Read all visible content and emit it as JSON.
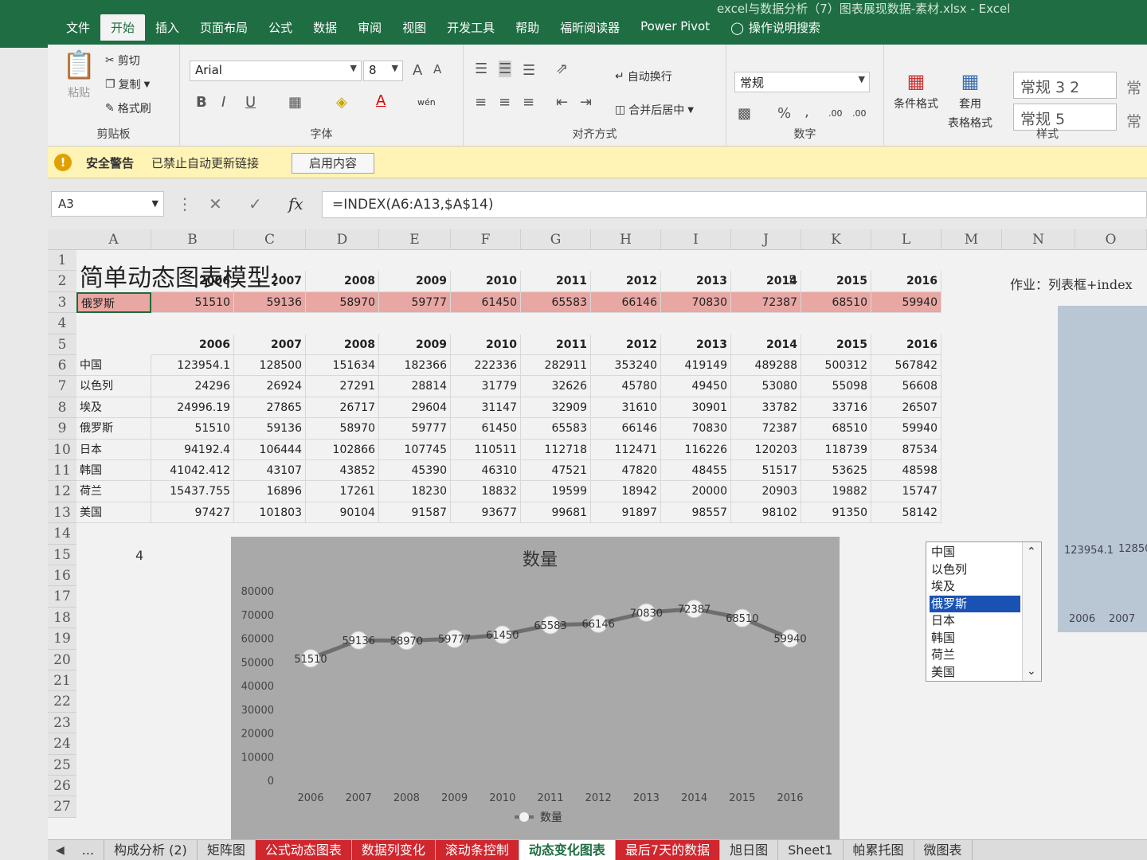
{
  "window": {
    "title": "excel与数据分析（7）图表展现数据-素材.xlsx  -  Excel"
  },
  "tabs": [
    "文件",
    "开始",
    "插入",
    "页面布局",
    "公式",
    "数据",
    "审阅",
    "视图",
    "开发工具",
    "帮助",
    "福昕阅读器",
    "Power Pivot"
  ],
  "tell_me": "操作说明搜索",
  "ribbon": {
    "clipboard": {
      "paste": "粘贴",
      "cut": "剪切",
      "copy": "复制",
      "format_painter": "格式刷",
      "label": "剪贴板"
    },
    "font": {
      "name": "Arial",
      "size": "8",
      "label": "字体",
      "bold": "B",
      "italic": "I",
      "underline": "U",
      "grow": "A",
      "shrink": "A",
      "font_color": "A",
      "phonetic": "wén"
    },
    "alignment": {
      "wrap": "自动换行",
      "merge": "合并后居中",
      "label": "对齐方式"
    },
    "number": {
      "format": "常规",
      "percent": "%",
      "comma": ",",
      "inc_decimal": ".00",
      "dec_decimal": ".00",
      "label": "数字"
    },
    "styles": {
      "conditional": "条件格式",
      "table": "套用",
      "table2": "表格格式",
      "style1": "常规 3 2",
      "style2": "常规 5",
      "style3": "常",
      "style4": "常",
      "label": "样式"
    }
  },
  "security_bar": {
    "title": "安全警告",
    "message": "已禁止自动更新链接",
    "button": "启用内容"
  },
  "formula_bar": {
    "name_box": "A3",
    "formula": "=INDEX(A6:A13,$A$14)"
  },
  "sheet": {
    "columns": [
      "A",
      "B",
      "C",
      "D",
      "E",
      "F",
      "G",
      "H",
      "I",
      "J",
      "K",
      "L",
      "M",
      "N",
      "O"
    ],
    "rows": [
      "1",
      "2",
      "3",
      "4",
      "5",
      "6",
      "7",
      "8",
      "9",
      "10",
      "11",
      "12",
      "13",
      "14",
      "15",
      "16",
      "17",
      "18",
      "19",
      "20",
      "21",
      "22",
      "23",
      "24",
      "25",
      "26",
      "27"
    ],
    "title": "简单动态图表模型:",
    "j1": "5",
    "n1": "作业：列表框+index",
    "years": [
      "2006",
      "2007",
      "2008",
      "2009",
      "2010",
      "2011",
      "2012",
      "2013",
      "2014",
      "2015",
      "2016"
    ],
    "selected_row": {
      "name": "俄罗斯",
      "values": [
        "51510",
        "59136",
        "58970",
        "59777",
        "61450",
        "65583",
        "66146",
        "70830",
        "72387",
        "68510",
        "59940"
      ]
    },
    "data_rows": [
      {
        "name": "中国",
        "values": [
          "123954.1",
          "128500",
          "151634",
          "182366",
          "222336",
          "282911",
          "353240",
          "419149",
          "489288",
          "500312",
          "567842"
        ]
      },
      {
        "name": "以色列",
        "values": [
          "24296",
          "26924",
          "27291",
          "28814",
          "31779",
          "32626",
          "45780",
          "49450",
          "53080",
          "55098",
          "56608"
        ]
      },
      {
        "name": "埃及",
        "values": [
          "24996.19",
          "27865",
          "26717",
          "29604",
          "31147",
          "32909",
          "31610",
          "30901",
          "33782",
          "33716",
          "26507"
        ]
      },
      {
        "name": "俄罗斯",
        "values": [
          "51510",
          "59136",
          "58970",
          "59777",
          "61450",
          "65583",
          "66146",
          "70830",
          "72387",
          "68510",
          "59940"
        ]
      },
      {
        "name": "日本",
        "values": [
          "94192.4",
          "106444",
          "102866",
          "107745",
          "110511",
          "112718",
          "112471",
          "116226",
          "120203",
          "118739",
          "87534"
        ]
      },
      {
        "name": "韩国",
        "values": [
          "41042.412",
          "43107",
          "43852",
          "45390",
          "46310",
          "47521",
          "47820",
          "48455",
          "51517",
          "53625",
          "48598"
        ]
      },
      {
        "name": "荷兰",
        "values": [
          "15437.755",
          "16896",
          "17261",
          "18230",
          "18832",
          "19599",
          "18942",
          "20000",
          "20903",
          "19882",
          "15747"
        ]
      },
      {
        "name": "美国",
        "values": [
          "97427",
          "101803",
          "90104",
          "91587",
          "93677",
          "99681",
          "91897",
          "98557",
          "98102",
          "91350",
          "58142"
        ]
      }
    ],
    "a14": "4"
  },
  "chart_data": {
    "type": "line",
    "title": "数量",
    "x": [
      "2006",
      "2007",
      "2008",
      "2009",
      "2010",
      "2011",
      "2012",
      "2013",
      "2014",
      "2015",
      "2016"
    ],
    "series": [
      {
        "name": "数量",
        "values": [
          51510,
          59136,
          58970,
          59777,
          61450,
          65583,
          66146,
          70830,
          72387,
          68510,
          59940
        ]
      }
    ],
    "yticks": [
      "80000",
      "70000",
      "60000",
      "50000",
      "40000",
      "30000",
      "20000",
      "10000",
      "0"
    ],
    "ylim": [
      0,
      80000
    ],
    "legend": "bottom",
    "colors": {
      "background": "#a9a9a9",
      "line": "#6e6e6e",
      "marker": "#f2f2f2"
    }
  },
  "listbox": {
    "items": [
      "中国",
      "以色列",
      "埃及",
      "俄罗斯",
      "日本",
      "韩国",
      "荷兰",
      "美国"
    ],
    "selected": "俄罗斯"
  },
  "mini_chart": {
    "label1": "123954.1",
    "label2": "12850",
    "x1": "2006",
    "x2": "2007"
  },
  "sheet_tabs": [
    {
      "label": "...",
      "style": "plain"
    },
    {
      "label": "构成分析 (2)",
      "style": "plain"
    },
    {
      "label": "矩阵图",
      "style": "plain"
    },
    {
      "label": "公式动态图表",
      "style": "red"
    },
    {
      "label": "数据列变化",
      "style": "red"
    },
    {
      "label": "滚动条控制",
      "style": "red"
    },
    {
      "label": "动态变化图表",
      "style": "active"
    },
    {
      "label": "最后7天的数据",
      "style": "red"
    },
    {
      "label": "旭日图",
      "style": "plain"
    },
    {
      "label": "Sheet1",
      "style": "plain"
    },
    {
      "label": "帕累托图",
      "style": "plain"
    },
    {
      "label": "微图表",
      "style": "plain"
    }
  ]
}
